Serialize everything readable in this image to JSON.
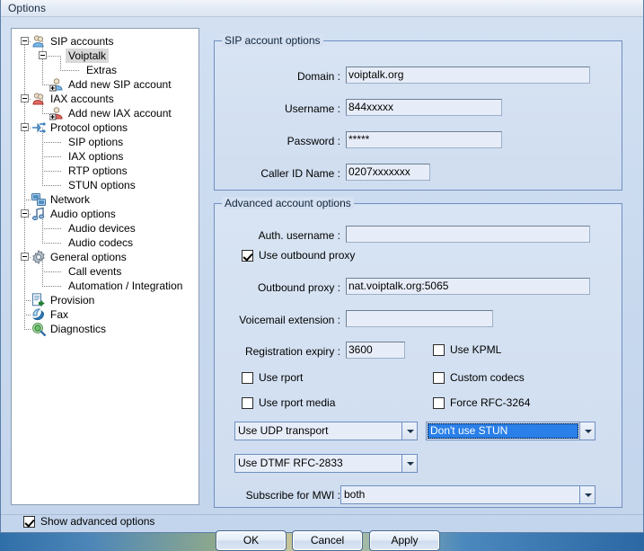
{
  "window": {
    "title": "Options"
  },
  "tree": {
    "nodes": [
      {
        "label": "SIP accounts",
        "icon": "users-blue-icon",
        "depth": 0,
        "expander": "minus",
        "selected": false
      },
      {
        "label": "Voiptalk",
        "icon": "none",
        "depth": 1,
        "expander": "minus",
        "selected": true
      },
      {
        "label": "Extras",
        "icon": "none",
        "depth": 2,
        "expander": "none",
        "selected": false
      },
      {
        "label": "Add new SIP account",
        "icon": "user-add-blue-icon",
        "depth": 1,
        "expander": "none",
        "selected": false
      },
      {
        "label": "IAX accounts",
        "icon": "users-red-icon",
        "depth": 0,
        "expander": "minus",
        "selected": false
      },
      {
        "label": "Add new IAX account",
        "icon": "user-add-red-icon",
        "depth": 1,
        "expander": "none",
        "selected": false
      },
      {
        "label": "Protocol options",
        "icon": "protocol-icon",
        "depth": 0,
        "expander": "minus",
        "selected": false
      },
      {
        "label": "SIP options",
        "icon": "none",
        "depth": 1,
        "expander": "none",
        "selected": false
      },
      {
        "label": "IAX options",
        "icon": "none",
        "depth": 1,
        "expander": "none",
        "selected": false
      },
      {
        "label": "RTP options",
        "icon": "none",
        "depth": 1,
        "expander": "none",
        "selected": false
      },
      {
        "label": "STUN options",
        "icon": "none",
        "depth": 1,
        "expander": "none",
        "selected": false
      },
      {
        "label": "Network",
        "icon": "network-icon",
        "depth": 0,
        "expander": "none",
        "selected": false
      },
      {
        "label": "Audio options",
        "icon": "audio-note-icon",
        "depth": 0,
        "expander": "minus",
        "selected": false
      },
      {
        "label": "Audio devices",
        "icon": "none",
        "depth": 1,
        "expander": "none",
        "selected": false
      },
      {
        "label": "Audio codecs",
        "icon": "none",
        "depth": 1,
        "expander": "none",
        "selected": false
      },
      {
        "label": "General options",
        "icon": "gear-icon",
        "depth": 0,
        "expander": "minus",
        "selected": false
      },
      {
        "label": "Call events",
        "icon": "none",
        "depth": 1,
        "expander": "none",
        "selected": false
      },
      {
        "label": "Automation / Integration",
        "icon": "none",
        "depth": 1,
        "expander": "none",
        "selected": false
      },
      {
        "label": "Provision",
        "icon": "provision-icon",
        "depth": 0,
        "expander": "none",
        "selected": false
      },
      {
        "label": "Fax",
        "icon": "fax-icon",
        "depth": 0,
        "expander": "none",
        "selected": false
      },
      {
        "label": "Diagnostics",
        "icon": "diagnostics-icon",
        "depth": 0,
        "expander": "none",
        "selected": false
      }
    ]
  },
  "sip_group": {
    "title": "SIP account options",
    "fields": [
      {
        "label": "Domain :",
        "value": "voiptalk.org"
      },
      {
        "label": "Username :",
        "value": "844xxxxx"
      },
      {
        "label": "Password :",
        "value": "*****"
      },
      {
        "label": "Caller ID Name :",
        "value": "0207xxxxxxx"
      }
    ]
  },
  "advanced_group": {
    "title": "Advanced account options",
    "auth_username_label": "Auth. username :",
    "auth_username_value": "",
    "use_outbound_proxy_label": "Use outbound proxy",
    "use_outbound_proxy_checked": true,
    "outbound_proxy_label": "Outbound proxy :",
    "outbound_proxy_value": "nat.voiptalk.org:5065",
    "voicemail_label": "Voicemail extension :",
    "voicemail_value": "",
    "registration_expiry_label": "Registration expiry  :",
    "registration_expiry_value": "3600",
    "use_kpml_label": "Use KPML",
    "use_kpml_checked": false,
    "use_rport_label": "Use rport",
    "use_rport_checked": false,
    "custom_codecs_label": "Custom codecs",
    "custom_codecs_checked": false,
    "use_rport_media_label": "Use rport media",
    "use_rport_media_checked": false,
    "force_rfc3264_label": "Force RFC-3264",
    "force_rfc3264_checked": false,
    "transport_value": "Use UDP transport",
    "stun_value": "Don't use STUN",
    "dtmf_value": "Use DTMF RFC-2833",
    "mwi_label": "Subscribe for MWI :",
    "mwi_value": "both"
  },
  "footer": {
    "show_advanced_label": "Show advanced options",
    "show_advanced_checked": true,
    "ok_label": "OK",
    "cancel_label": "Cancel",
    "apply_label": "Apply"
  },
  "colors": {
    "accent_selection": "#2a7fe8",
    "group_border": "#6f8fc2",
    "panel_bg": "#cddcf0"
  }
}
